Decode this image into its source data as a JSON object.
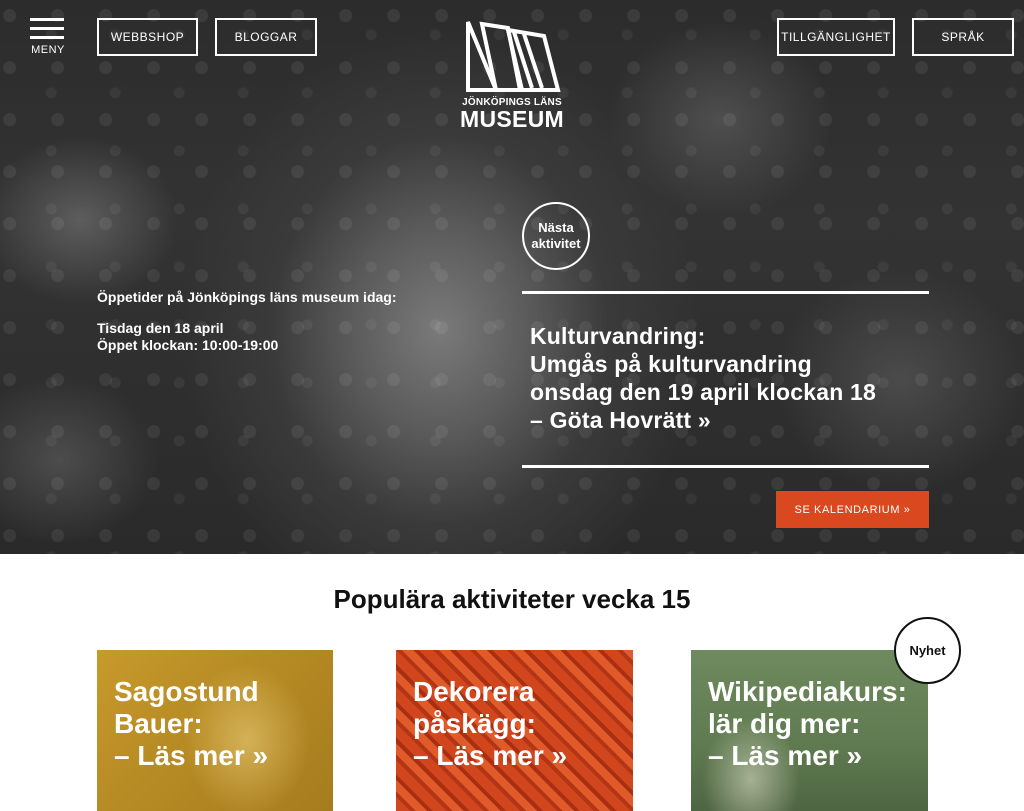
{
  "header": {
    "menu_label": "MENY",
    "webshop_label": "WEBBSHOP",
    "blogs_label": "BLOGGAR",
    "accessibility_label": "TILLGÄNGLIGHET",
    "language_label": "SPRÅK",
    "logo_small": "JÖNKÖPINGS LÄNS",
    "logo_big": "MUSEUM"
  },
  "hero": {
    "next_badge": [
      "Nästa",
      "aktivitet"
    ],
    "hours_intro": "Öppetider på Jönköpings läns museum idag:",
    "hours_date": "Tisdag den 18 april",
    "hours_time": "Öppet klockan: 10:00-19:00",
    "event_lines": [
      "Kulturvandring:",
      "Umgås på kulturvandring",
      "onsdag den 19 april klockan 18",
      "– Göta Hovrätt »"
    ],
    "calendar_button": "SE KALENDARIUM »"
  },
  "popular": {
    "title": "Populära aktiviteter vecka 15",
    "new_badge": "Nyhet",
    "cards": [
      {
        "lines": [
          "Sagostund",
          "Bauer:",
          "– Läs mer »"
        ]
      },
      {
        "lines": [
          "Dekorera",
          "påskägg:",
          "– Läs mer »"
        ]
      },
      {
        "lines": [
          "Wikipediakurs:",
          "lär dig mer:",
          "– Läs mer »"
        ]
      }
    ]
  },
  "colors": {
    "accent": "#d9481e",
    "hero_bg": "#2e2e2e",
    "card1": "#b58923",
    "card2": "#d2461e",
    "card3": "#5f7a50"
  }
}
